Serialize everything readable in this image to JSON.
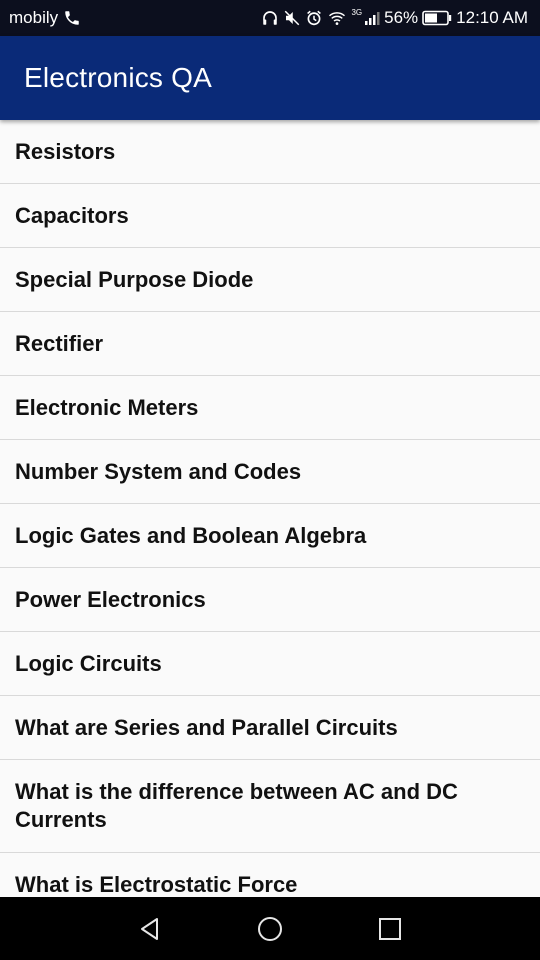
{
  "status_bar": {
    "carrier": "mobily",
    "network_type": "3G",
    "battery": "56%",
    "time": "12:10 AM",
    "icons": [
      "call-icon",
      "headset-icon",
      "mute-icon",
      "alarm-icon",
      "wifi-icon",
      "signal-icon",
      "battery-icon"
    ]
  },
  "app_bar": {
    "title": "Electronics QA"
  },
  "list": {
    "items": [
      {
        "label": "Resistors"
      },
      {
        "label": "Capacitors"
      },
      {
        "label": "Special Purpose Diode"
      },
      {
        "label": "Rectifier"
      },
      {
        "label": "Electronic Meters"
      },
      {
        "label": "Number System and Codes"
      },
      {
        "label": "Logic Gates and Boolean Algebra"
      },
      {
        "label": "Power Electronics"
      },
      {
        "label": "Logic Circuits"
      },
      {
        "label": "What are Series and Parallel Circuits"
      },
      {
        "label": "What is the difference between AC and DC Currents"
      },
      {
        "label": "What is Electrostatic Force"
      }
    ]
  },
  "nav_bar": {
    "icons": [
      "back-icon",
      "home-icon",
      "recents-icon"
    ]
  },
  "colors": {
    "status_bar": "#0c0f1e",
    "app_bar": "#0a2a78",
    "list_background": "#fafafa",
    "divider": "#d9d9d9",
    "nav_bar": "#000000"
  }
}
